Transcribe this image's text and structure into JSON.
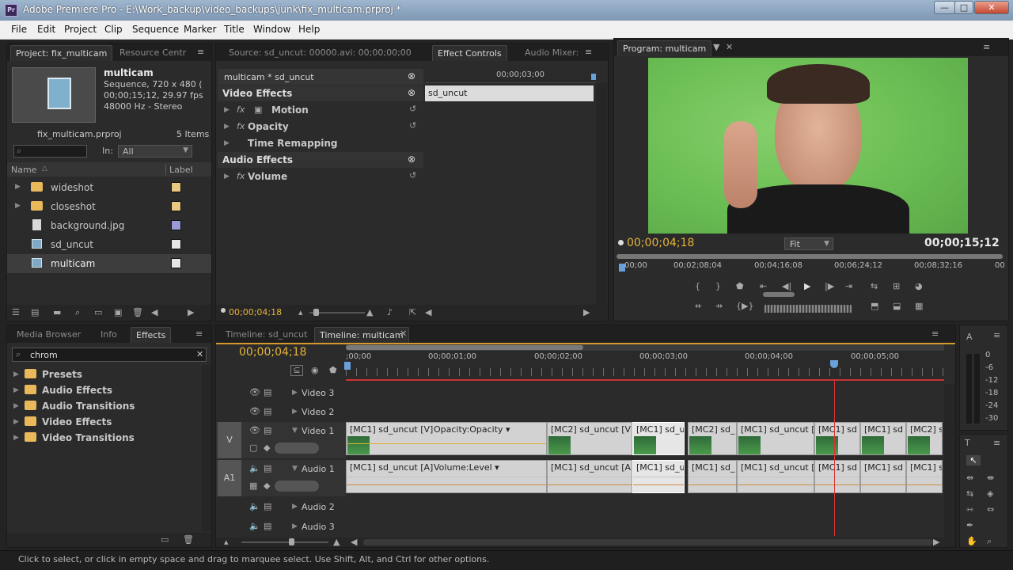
{
  "window": {
    "app_icon": "Pr",
    "title": "Adobe Premiere Pro - E:\\Work_backup\\video_backups\\junk\\fix_multicam.prproj *",
    "controls": [
      "—",
      "□",
      "✕"
    ]
  },
  "menu": [
    "File",
    "Edit",
    "Project",
    "Clip",
    "Sequence",
    "Marker",
    "Title",
    "Window",
    "Help"
  ],
  "project_panel": {
    "tabs": [
      "Project: fix_multicam",
      "Resource Centr"
    ],
    "item_name": "multicam",
    "item_info": [
      "Sequence, 720 x 480 (",
      "00;00;15;12, 29.97 fps",
      "48000 Hz - Stereo"
    ],
    "project_file": "fix_multicam.prproj",
    "item_count": "5 Items",
    "in_label": "In:",
    "in_value": "All",
    "col_name": "Name",
    "col_label": "Label",
    "items": [
      {
        "name": "wideshot",
        "type": "folder",
        "color": "#e8c880"
      },
      {
        "name": "closeshot",
        "type": "folder",
        "color": "#e8c880"
      },
      {
        "name": "background.jpg",
        "type": "file",
        "color": "#9a9ad6"
      },
      {
        "name": "sd_uncut",
        "type": "clip",
        "color": "#e6e6e6"
      },
      {
        "name": "multicam",
        "type": "clip",
        "color": "#e6e6e6"
      }
    ]
  },
  "source_panel": {
    "tabs": [
      "Source: sd_uncut: 00000.avi: 00;00;00;00",
      "Effect Controls",
      "Audio Mixer:"
    ],
    "sequence_label": "multicam * sd_uncut",
    "ruler_time": "00;00;03;00",
    "clip_label": "sd_uncut",
    "video_effects": "Video Effects",
    "audio_effects": "Audio Effects",
    "effects": [
      "Motion",
      "Opacity",
      "Time Remapping"
    ],
    "audio": [
      "Volume"
    ],
    "timecode": "00;00;04;18"
  },
  "program_panel": {
    "tab": "Program: multicam",
    "timecode": "00;00;04;18",
    "duration": "00;00;15;12",
    "fit": "Fit",
    "ruler": [
      "00;00",
      "00;02;08;04",
      "00;04;16;08",
      "00;06;24;12",
      "00;08;32;16",
      "00"
    ]
  },
  "effects_panel": {
    "tabs": [
      "Media Browser",
      "Info",
      "Effects"
    ],
    "search": "chrom",
    "folders": [
      "Presets",
      "Audio Effects",
      "Audio Transitions",
      "Video Effects",
      "Video Transitions"
    ]
  },
  "timeline": {
    "tabs": [
      "Timeline: sd_uncut",
      "Timeline: multicam"
    ],
    "timecode": "00;00;04;18",
    "ruler": [
      ";00;00",
      "00;00;01;00",
      "00;00;02;00",
      "00;00;03;00",
      "00;00;04;00",
      "00;00;05;00"
    ],
    "tracks_video": [
      "Video 3",
      "Video 2",
      "Video 1"
    ],
    "tracks_audio": [
      "Audio 1",
      "Audio 2",
      "Audio 3"
    ],
    "v_label": "V",
    "a_label": "A1",
    "video_clips": [
      {
        "label": "[MC1] sd_uncut [V]",
        "extra": "Opacity:Opacity ▾"
      },
      {
        "label": "[MC2] sd_uncut [V]"
      },
      {
        "label": "[MC1] sd_ur"
      },
      {
        "label": "[MC2] sd_"
      },
      {
        "label": "[MC1] sd_uncut [V"
      },
      {
        "label": "[MC1] sd"
      },
      {
        "label": "[MC1] sd"
      },
      {
        "label": "[MC2] s"
      }
    ],
    "audio_clips": [
      {
        "label": "[MC1] sd_uncut [A]",
        "extra": "Volume:Level ▾"
      },
      {
        "label": "[MC1] sd_uncut [A]"
      },
      {
        "label": "[MC1] sd_ur"
      },
      {
        "label": "[MC1] sd_"
      },
      {
        "label": "[MC1] sd_uncut [/"
      },
      {
        "label": "[MC1] sd"
      },
      {
        "label": "[MC1] sd"
      },
      {
        "label": "[MC1] s"
      }
    ]
  },
  "tools_panel": {
    "meter_labels": [
      "0",
      "-6",
      "-12",
      "-18",
      "-24",
      "-30"
    ]
  },
  "status": "Click to select, or click in empty space and drag to marquee select. Use Shift, Alt, and Ctrl for other options."
}
